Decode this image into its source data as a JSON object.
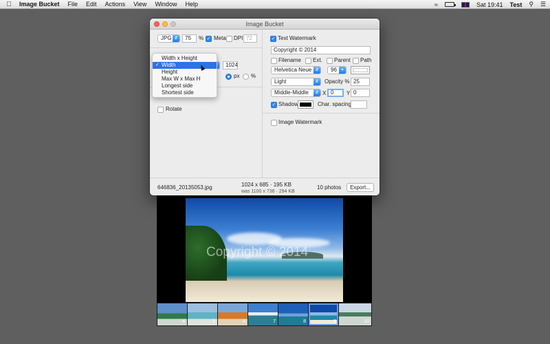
{
  "menubar": {
    "app": "Image Bucket",
    "items": [
      "File",
      "Edit",
      "Actions",
      "View",
      "Window",
      "Help"
    ],
    "clock": "Sat 19:41",
    "user": "Test"
  },
  "window": {
    "title": "Image Bucket",
    "format": "JPG",
    "quality": "75",
    "quality_unit": "%",
    "meta_label": "Meta",
    "dpi_label": "DPI",
    "dpi_value": "72",
    "resize_value": "1024",
    "unit_px": "px",
    "unit_pct": "%",
    "rotate_label": "Rotate"
  },
  "resize_menu": {
    "options": [
      "Width x Height",
      "Width",
      "Height",
      "Max W x Max H",
      "Longest side",
      "Shortest side"
    ],
    "selected": "Width"
  },
  "text_watermark": {
    "label": "Text Watermark",
    "text": "Copyright © 2014",
    "filename_label": "Filename",
    "ext_label": "Ext.",
    "parent_label": "Parent",
    "path_label": "Path",
    "font": "Helvetica Neue",
    "size": "96",
    "weight": "Light",
    "opacity_label": "Opacity %",
    "opacity": "25",
    "position": "Middle-Middle",
    "x_label": "X",
    "x": "0",
    "y_label": "Y",
    "y": "0",
    "shadow_label": "Shadow",
    "char_spacing_label": "Char. spacing",
    "text_color": "#ffffff",
    "shadow_color": "#000000"
  },
  "image_watermark": {
    "label": "Image Watermark"
  },
  "footer": {
    "filename": "646836_20135053.jpg",
    "output_size": "1024 x 685 · 195 KB",
    "original_size": "was 1100 x 736 · 294 KB",
    "count": "10 photos",
    "export_label": "Export..."
  },
  "preview": {
    "watermark_text": "Copyright © 2014"
  },
  "thumbnails": [
    {
      "num": "4",
      "selected": false
    },
    {
      "num": "5",
      "selected": false
    },
    {
      "num": "6",
      "selected": false
    },
    {
      "num": "7",
      "selected": false
    },
    {
      "num": "8",
      "selected": false
    },
    {
      "num": "9",
      "selected": true
    },
    {
      "num": "10",
      "selected": false
    }
  ]
}
